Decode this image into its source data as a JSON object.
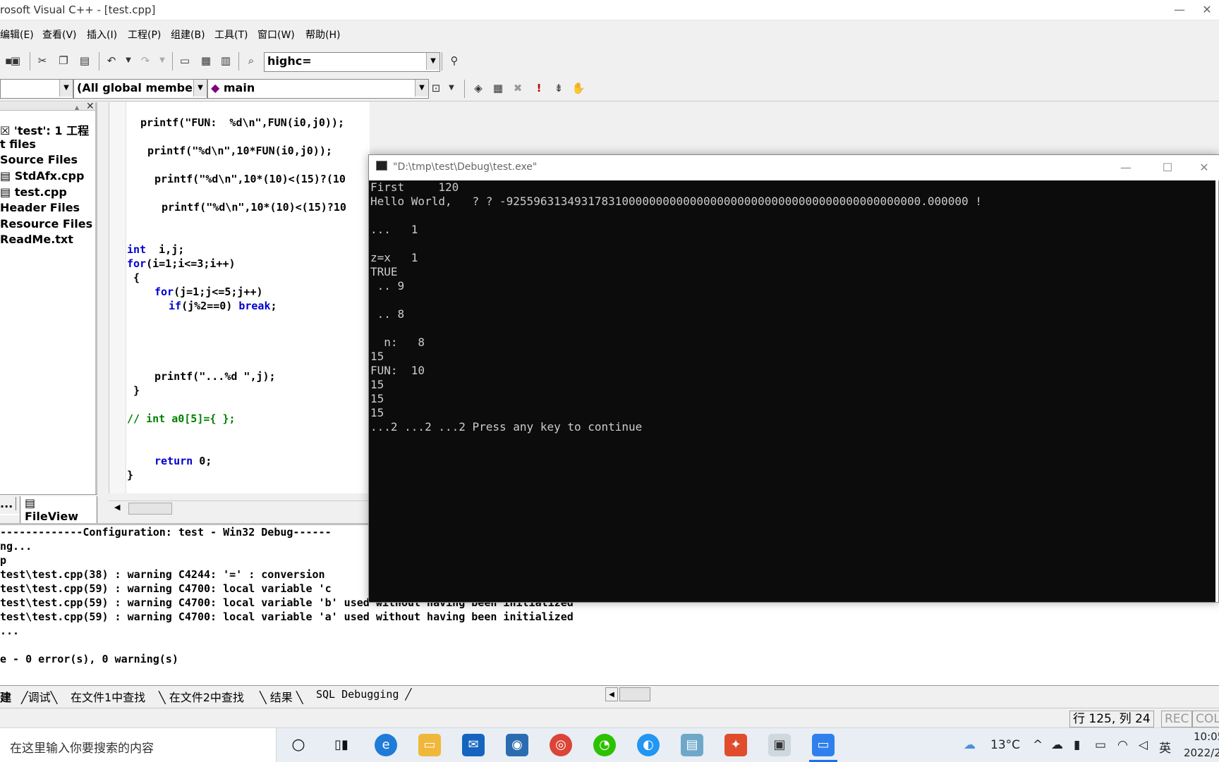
{
  "window": {
    "title": "rosoft Visual C++ - [test.cpp]",
    "controls": [
      "—",
      "☐",
      "✕"
    ]
  },
  "menu": [
    "编辑(E)",
    "查看(V)",
    "插入(I)",
    "工程(P)",
    "组建(B)",
    "工具(T)",
    "窗口(W)",
    "帮助(H)"
  ],
  "toolbar": {
    "find_combo_value": "highc=",
    "scope_combo_value": "(All global members",
    "function_combo_value": "main"
  },
  "workspace": {
    "tree": [
      "'test': 1 工程",
      "t files",
      "Source Files",
      "StdAfx.cpp",
      "test.cpp",
      "Header Files",
      "Resource Files",
      "ReadMe.txt"
    ],
    "tab_left": "...",
    "tab_fileview": "FileView"
  },
  "editor": {
    "lines": [
      "printf(\"FUN:  %d\\n\",FUN(i0,j0));",
      "printf(\"%d\\n\",10*FUN(i0,j0));",
      "printf(\"%d\\n\",10*(10)<(15)?(10",
      "printf(\"%d\\n\",10*(10)<(15)?10",
      "i,j;",
      "(i=1;i<=3;i++)",
      "{",
      "(j=1;j<=5;j++)",
      "(j%2==0) ",
      ";",
      "printf(\"...%d \",j);",
      "}",
      "// int a0[5]={ };",
      "0;",
      "}"
    ],
    "keywords": {
      "int": "int",
      "for": "for",
      "if": "if",
      "break": "break",
      "return": "return"
    }
  },
  "output": {
    "lines": [
      "-------------Configuration: test - Win32 Debug------",
      "ng...",
      "p",
      "test\\test.cpp(38) : warning C4244: '=' : conversion",
      "test\\test.cpp(59) : warning C4700: local variable 'c",
      "test\\test.cpp(59) : warning C4700: local variable 'b' used without having been initialized",
      "test\\test.cpp(59) : warning C4700: local variable 'a' used without having been initialized",
      "...",
      "",
      "e - 0 error(s), 0 warning(s)"
    ],
    "tabs": [
      "建",
      "调试",
      "在文件1中查找",
      "在文件2中查找",
      "结果",
      "SQL Debugging"
    ]
  },
  "status": {
    "position": "行 125, 列 24",
    "rec": "REC",
    "col": "COL"
  },
  "console": {
    "title": "\"D:\\tmp\\test\\Debug\\test.exe\"",
    "lines": [
      "First     120",
      "Hello World,   ? ? -9255963134931783100000000000000000000000000000000000000000000.000000 !",
      "",
      "...   1",
      "",
      "z=x   1",
      "TRUE",
      " .. 9",
      "",
      " .. 8",
      "",
      "  n:   8",
      "15",
      "FUN:  10",
      "15",
      "15",
      "15",
      "...2 ...2 ...2 Press any key to continue"
    ]
  },
  "taskbar": {
    "search_placeholder": "在这里输入你要搜索的内容",
    "weather": "13°C",
    "ime": "英",
    "time": "10:05",
    "date": "2022/2"
  }
}
